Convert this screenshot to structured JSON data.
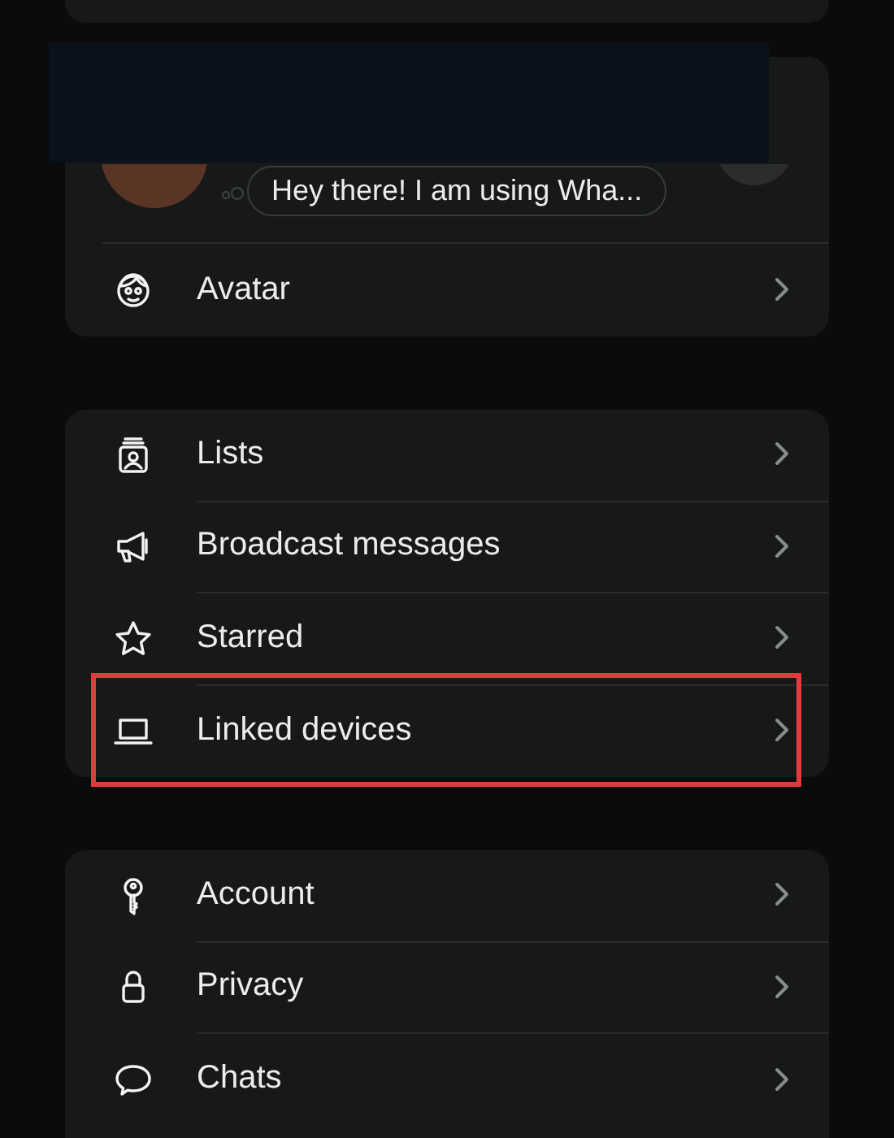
{
  "profile": {
    "status": "Hey there! I am using Wha..."
  },
  "sections": [
    {
      "items": [
        {
          "kind": "avatar",
          "label": "Avatar",
          "highlighted": false
        }
      ]
    },
    {
      "items": [
        {
          "kind": "lists",
          "label": "Lists",
          "highlighted": false
        },
        {
          "kind": "broadcast",
          "label": "Broadcast messages",
          "highlighted": false
        },
        {
          "kind": "star",
          "label": "Starred",
          "highlighted": false
        },
        {
          "kind": "laptop",
          "label": "Linked devices",
          "highlighted": true
        }
      ]
    },
    {
      "items": [
        {
          "kind": "key",
          "label": "Account",
          "highlighted": false
        },
        {
          "kind": "lock",
          "label": "Privacy",
          "highlighted": false
        },
        {
          "kind": "chat",
          "label": "Chats",
          "highlighted": false
        }
      ]
    }
  ]
}
